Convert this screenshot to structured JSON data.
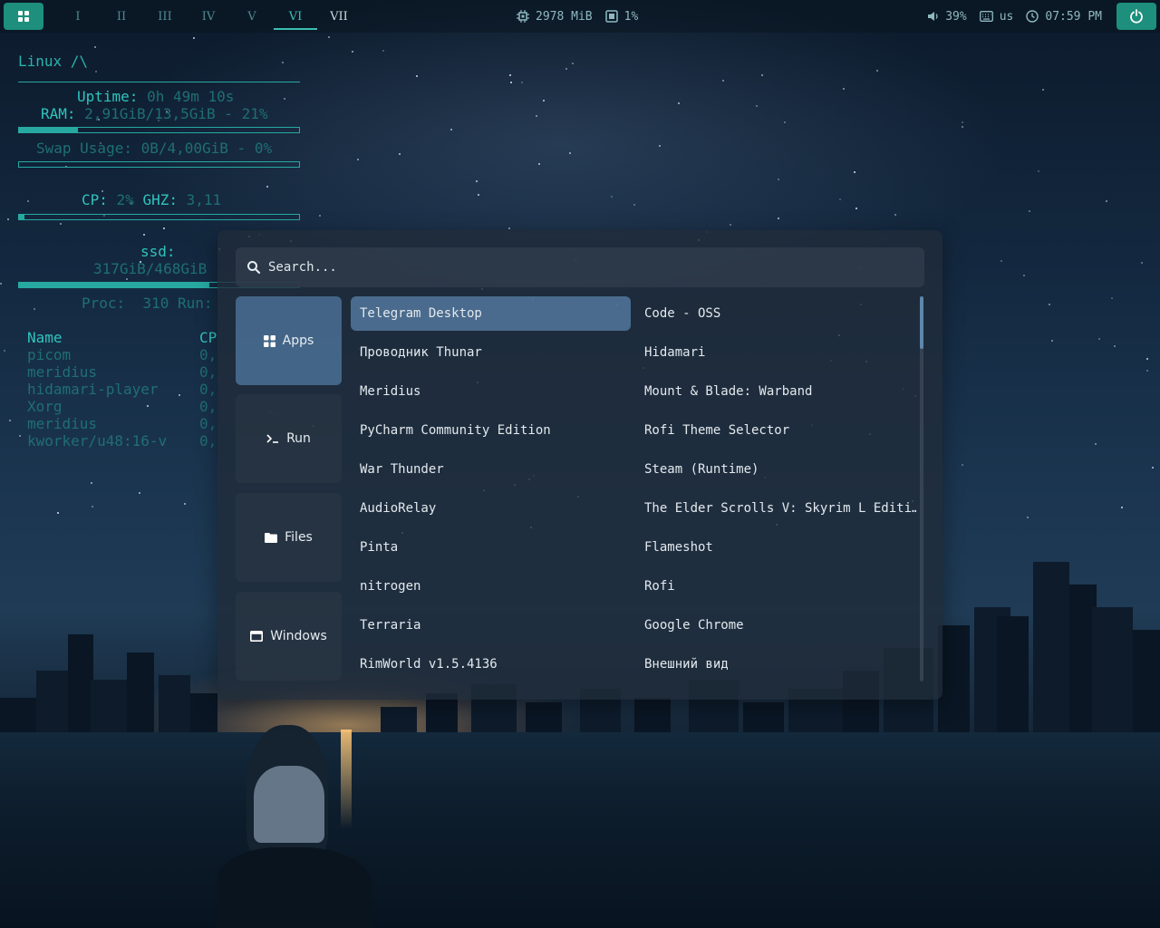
{
  "topbar": {
    "workspaces": [
      "I",
      "II",
      "III",
      "IV",
      "V",
      "VI",
      "VII"
    ],
    "active_workspace": "VI",
    "memory": "2978 MiB",
    "cpu": "1%",
    "volume": "39%",
    "keyboard_layout": "us",
    "clock": "07:59 PM",
    "accent_color": "#1d8f7c"
  },
  "conky": {
    "title": "Linux /\\",
    "uptime_label": "Uptime:",
    "uptime_value": "0h 49m 10s",
    "ram_label": "RAM:",
    "ram_value": "2,91GiB/13,5GiB - 21%",
    "ram_fraction": 0.21,
    "swap_text": "Swap Usage: 0B/4,00GiB - 0%",
    "swap_fraction": 0.0,
    "cpu_label": "CP:",
    "cpu_value": "2%",
    "ghz_label": "GHZ:",
    "ghz_value": "3,11",
    "cpu_fraction": 0.02,
    "ssd_label": "ssd:",
    "ssd_value": "317GiB/468GiB",
    "ssd_fraction": 0.68,
    "proc_text": "Proc:  310 Run:",
    "process_header_name": "Name",
    "process_header_cpu": "CP",
    "processes": [
      {
        "name": "picom",
        "cpu": "0,"
      },
      {
        "name": "meridius",
        "cpu": "0,"
      },
      {
        "name": "hidamari-player",
        "cpu": "0,"
      },
      {
        "name": "Xorg",
        "cpu": "0,"
      },
      {
        "name": "meridius",
        "cpu": "0,"
      },
      {
        "name": "kworker/u48:16-v",
        "cpu": "0,"
      }
    ]
  },
  "rofi": {
    "search_placeholder": "Search...",
    "modes": [
      {
        "label": "Apps",
        "icon": "grid-icon"
      },
      {
        "label": "Run",
        "icon": "terminal-icon"
      },
      {
        "label": "Files",
        "icon": "folder-icon"
      },
      {
        "label": "Windows",
        "icon": "window-icon"
      }
    ],
    "active_mode": "Apps",
    "items_left": [
      "Telegram Desktop",
      "Проводник Thunar",
      "Meridius",
      "PyCharm Community Edition",
      "War Thunder",
      "AudioRelay",
      "Pinta",
      "nitrogen",
      "Terraria",
      "RimWorld v1.5.4136"
    ],
    "items_right": [
      "Code - OSS",
      "Hidamari",
      "Mount & Blade: Warband",
      "Rofi Theme Selector",
      "Steam (Runtime)",
      "The Elder Scrolls V: Skyrim L Editi…",
      "Flameshot",
      "Rofi",
      "Google Chrome",
      "Внешний вид"
    ],
    "selected_item": "Telegram Desktop"
  }
}
